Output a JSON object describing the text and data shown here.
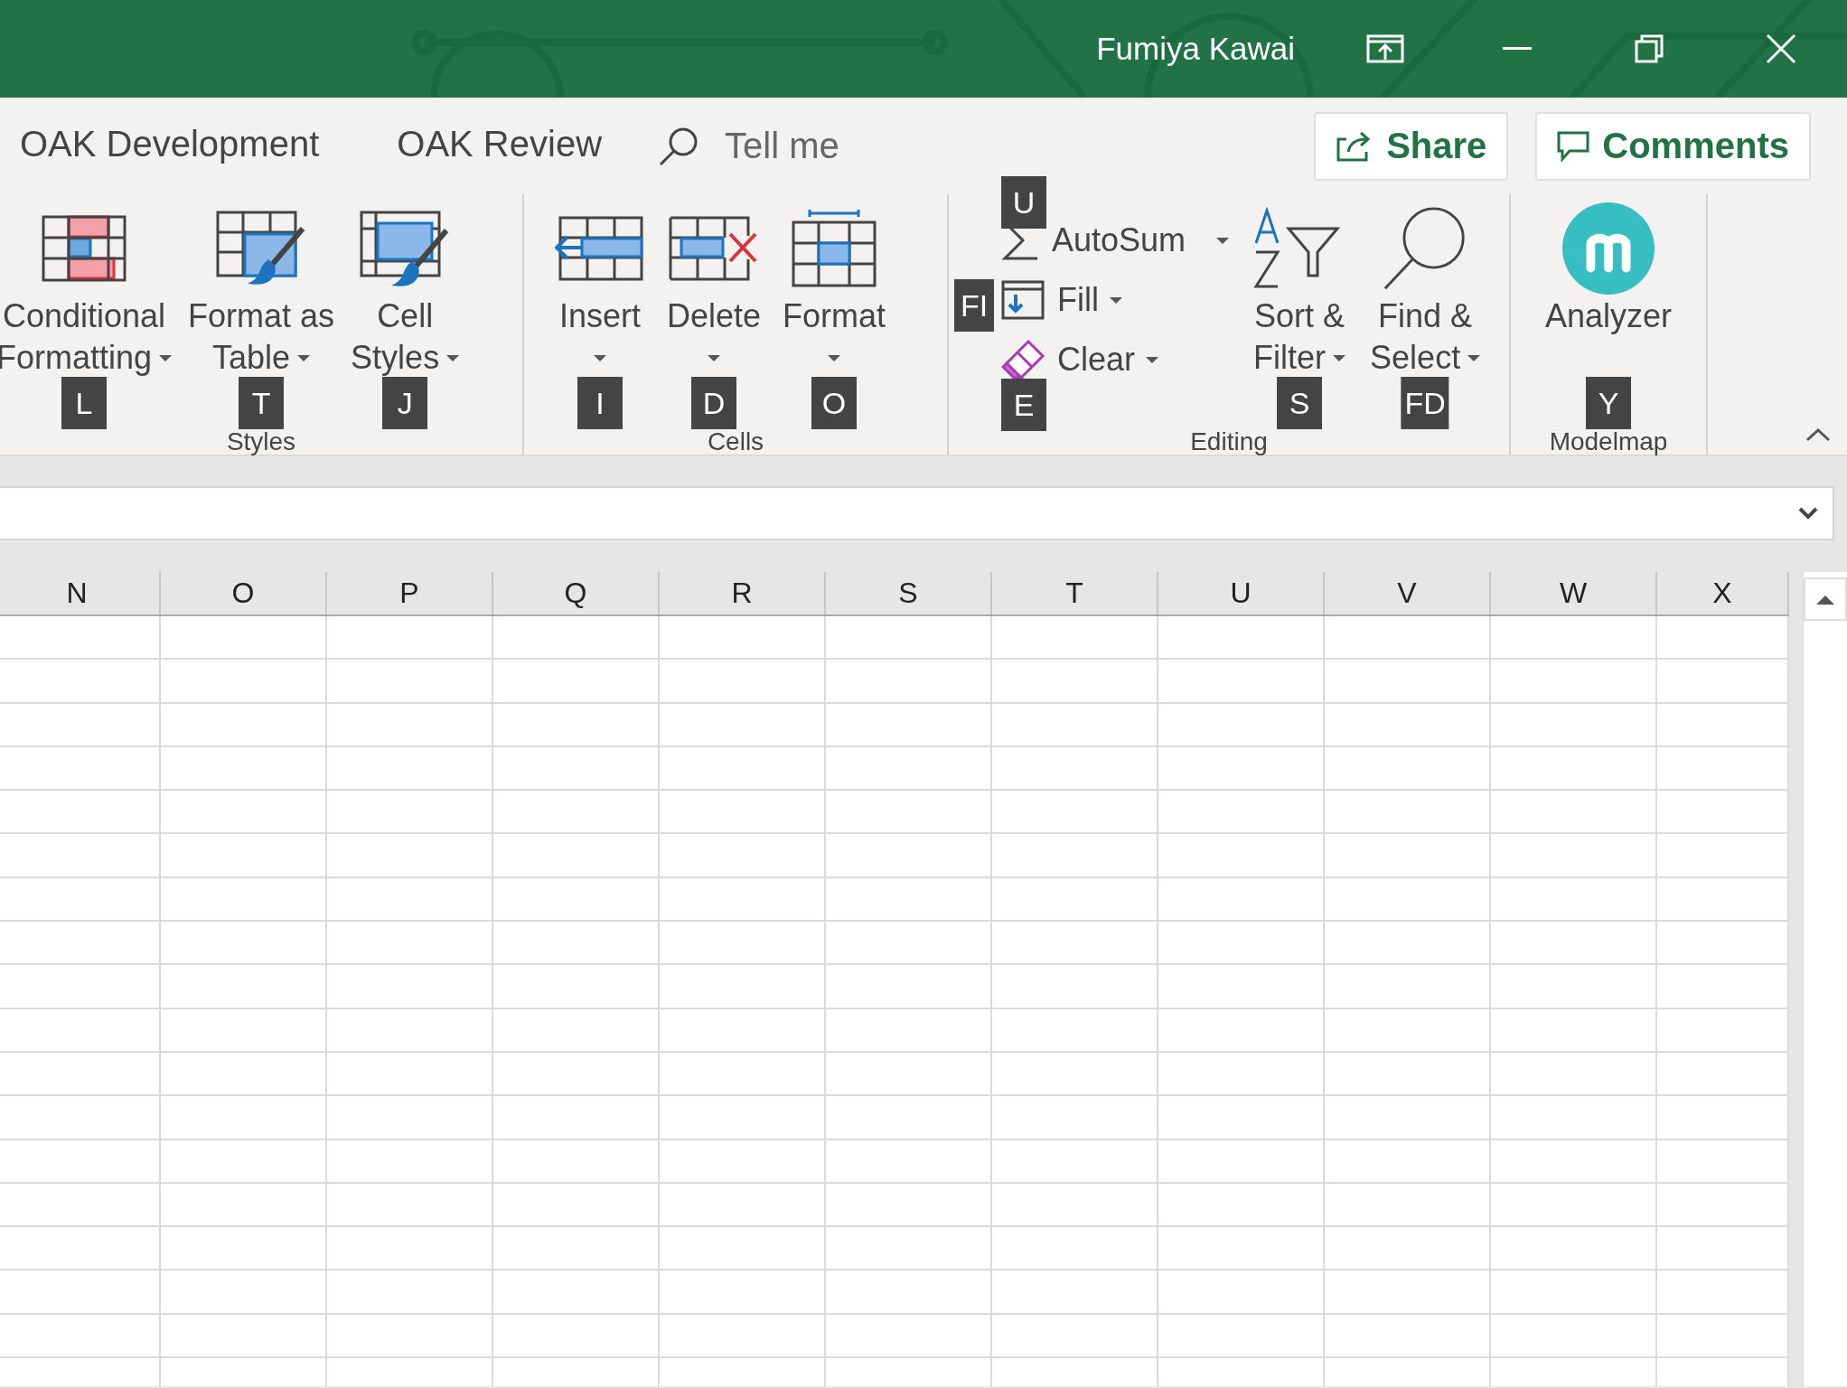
{
  "title_bar": {
    "user_name": "Fumiya Kawai"
  },
  "tabs": [
    {
      "label": "OAK Development",
      "selected": false
    },
    {
      "label": "OAK Review",
      "selected": false
    }
  ],
  "tell_me": {
    "placeholder": "Tell me"
  },
  "share_button": {
    "label": "Share"
  },
  "comments_button": {
    "label": "Comments"
  },
  "ribbon_groups": [
    {
      "label": "Styles",
      "buttons": [
        {
          "kind": "large",
          "lines": [
            "Conditional",
            "Formatting"
          ],
          "dropdown": true,
          "keytip": "L"
        },
        {
          "kind": "large",
          "lines": [
            "Format as",
            "Table"
          ],
          "dropdown": true,
          "keytip": "T"
        },
        {
          "kind": "large",
          "lines": [
            "Cell",
            "Styles"
          ],
          "dropdown": true,
          "keytip": "J"
        }
      ]
    },
    {
      "label": "Cells",
      "buttons": [
        {
          "kind": "large",
          "lines": [
            "Insert"
          ],
          "dropdown": true,
          "keytip": "I"
        },
        {
          "kind": "large",
          "lines": [
            "Delete"
          ],
          "dropdown": true,
          "keytip": "D"
        },
        {
          "kind": "large",
          "lines": [
            "Format"
          ],
          "dropdown": true,
          "keytip": "O"
        }
      ]
    },
    {
      "label": "Editing",
      "buttons": [
        {
          "kind": "small",
          "lines": [
            "AutoSum"
          ],
          "dropdown": true,
          "keytip": "U"
        },
        {
          "kind": "small",
          "lines": [
            "Fill"
          ],
          "dropdown": true,
          "keytip": "FI"
        },
        {
          "kind": "small",
          "lines": [
            "Clear"
          ],
          "dropdown": true,
          "keytip": "E"
        },
        {
          "kind": "large",
          "lines": [
            "Sort &",
            "Filter"
          ],
          "dropdown": true,
          "keytip": "S"
        },
        {
          "kind": "large",
          "lines": [
            "Find &",
            "Select"
          ],
          "dropdown": true,
          "keytip": "FD"
        }
      ]
    },
    {
      "label": "Modelmap",
      "buttons": [
        {
          "kind": "large",
          "lines": [
            "Analyzer"
          ],
          "dropdown": false,
          "keytip": "Y"
        }
      ]
    }
  ],
  "columns": [
    "N",
    "O",
    "P",
    "Q",
    "R",
    "S",
    "T",
    "U",
    "V",
    "W",
    "X"
  ]
}
